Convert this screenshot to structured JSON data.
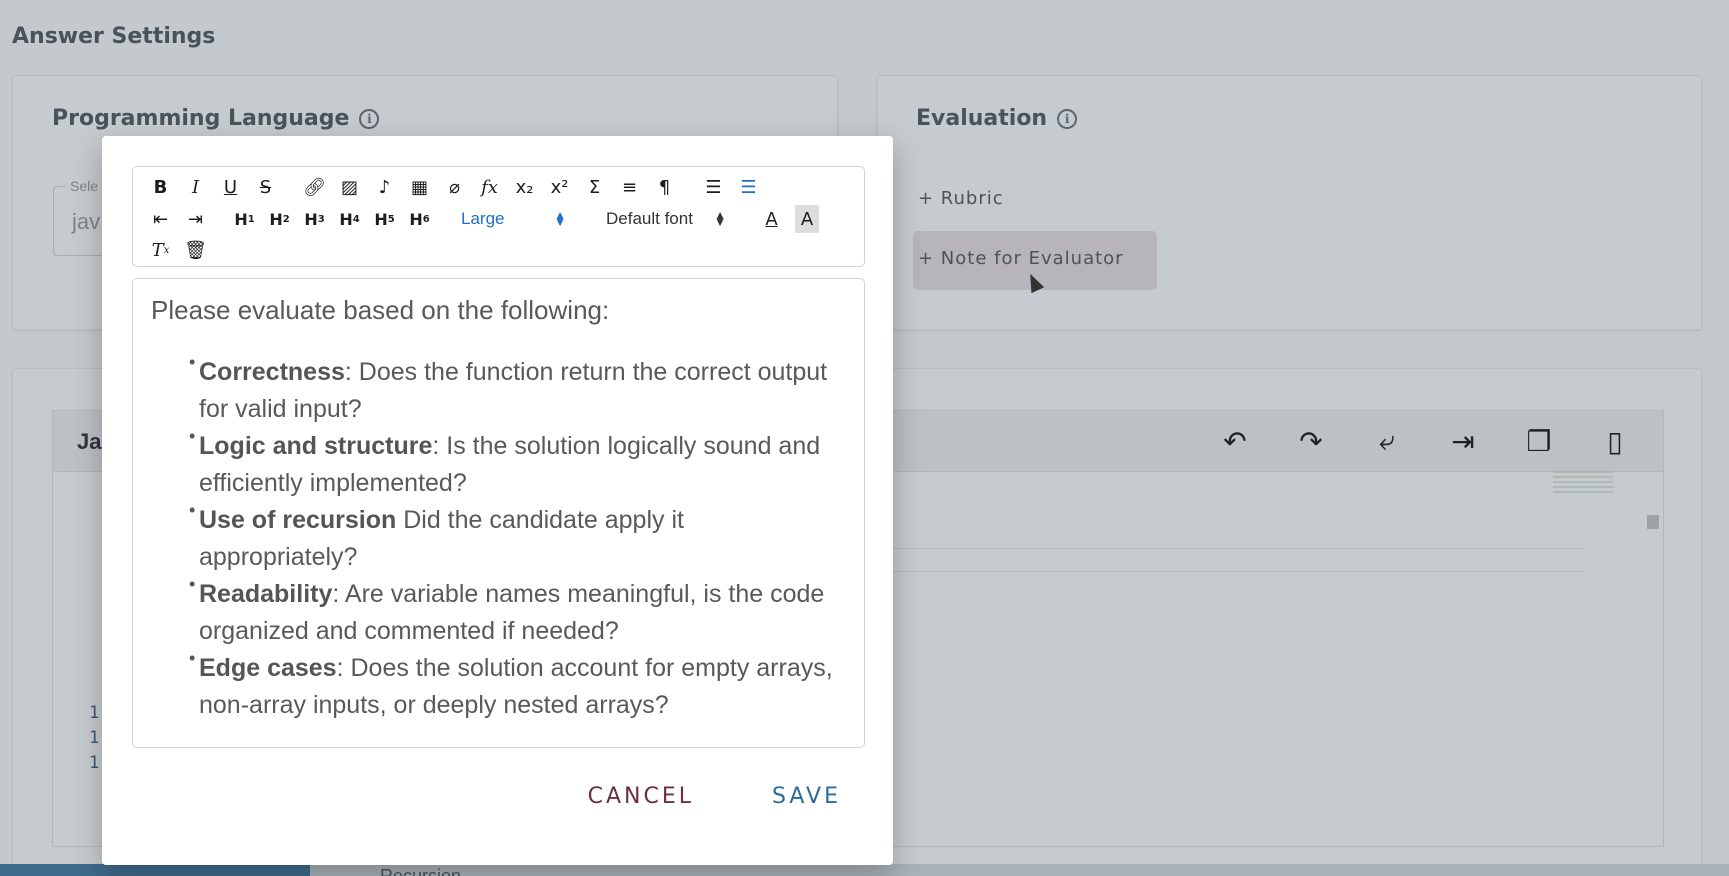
{
  "page": {
    "title": "Answer Settings"
  },
  "programming_language": {
    "title": "Programming Language",
    "select_legend": "Sele",
    "select_value": "jav"
  },
  "evaluation": {
    "title": "Evaluation",
    "rubric_label": "+ Rubric",
    "note_label": "+ Note for Evaluator"
  },
  "code_editor": {
    "language_label": "Ja",
    "line_numbers": [
      "1",
      "1",
      "1"
    ],
    "tools": [
      "undo-icon",
      "redo-icon",
      "wrap-icon",
      "indent-icon",
      "copy-icon",
      "mobile-icon"
    ]
  },
  "bottom_bar": {
    "text": "Recursion"
  },
  "modal": {
    "toolbar": {
      "font_size": "Large",
      "font_family": "Default font",
      "heading_labels": [
        "H1",
        "H2",
        "H3",
        "H4",
        "H5",
        "H6"
      ],
      "active_color": "#1f6fc9"
    },
    "content": {
      "intro": "Please evaluate based on the following:",
      "criteria": [
        {
          "term": "Correctness",
          "sep": ":",
          "text": " Does the function return the correct output for valid input?"
        },
        {
          "term": "Logic and structure",
          "sep": ":",
          "text": " Is the solution logically sound and efficiently implemented?"
        },
        {
          "term": "Use of recursion",
          "sep": "",
          "text": " Did the candidate apply it appropriately?"
        },
        {
          "term": "Readability",
          "sep": ":",
          "text": " Are variable names meaningful, is the code organized and commented if needed?"
        },
        {
          "term": "Edge cases",
          "sep": ":",
          "text": " Does the solution account for empty arrays, non-array inputs, or deeply nested arrays?"
        }
      ]
    },
    "cancel_label": "CANCEL",
    "save_label": "SAVE"
  }
}
